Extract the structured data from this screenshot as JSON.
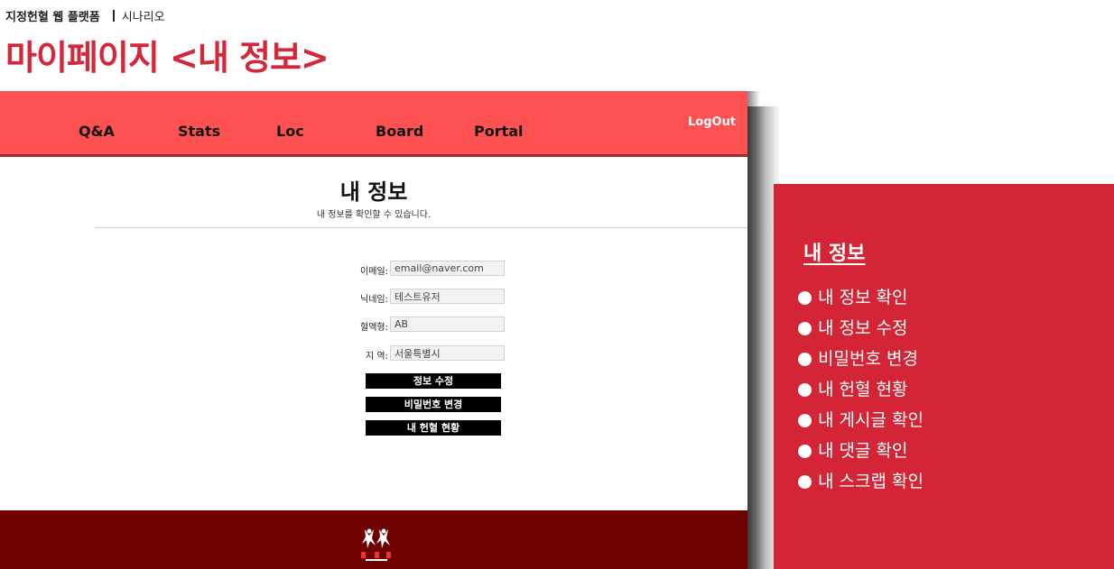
{
  "slide": {
    "project": "지정헌혈 웹 플랫폼",
    "section": "시나리오",
    "title": "마이페이지 <내 정보>"
  },
  "nav": {
    "items": [
      "Q&A",
      "Stats",
      "Loc",
      "Board",
      "Portal"
    ],
    "logout": "LogOut"
  },
  "page": {
    "title": "내 정보",
    "subtitle": "내 정보를 확인할 수 있습니다."
  },
  "form": {
    "email_label": "이메일:",
    "email_value": "email@naver.com",
    "nickname_label": "닉네임:",
    "nickname_value": "테스트유저",
    "blood_label": "혈액형:",
    "blood_value": "AB",
    "region_label": "지 역:",
    "region_value": "서울특별시"
  },
  "actions": {
    "edit": "정보 수정",
    "password": "비밀번호 변경",
    "history": "내 헌혈 현황"
  },
  "panel": {
    "title": "내 정보",
    "items": [
      "내 정보 확인",
      "내 정보 수정",
      "비밀번호 변경",
      "내 헌혈 현황",
      "내 게시글 확인",
      "내 댓글 확인",
      "내 스크랩 확인"
    ]
  },
  "colors": {
    "accent": "#d4273a",
    "nav_bg": "#fe5151",
    "footer_bg": "#6e0000",
    "panel_bg": "#d32535"
  }
}
